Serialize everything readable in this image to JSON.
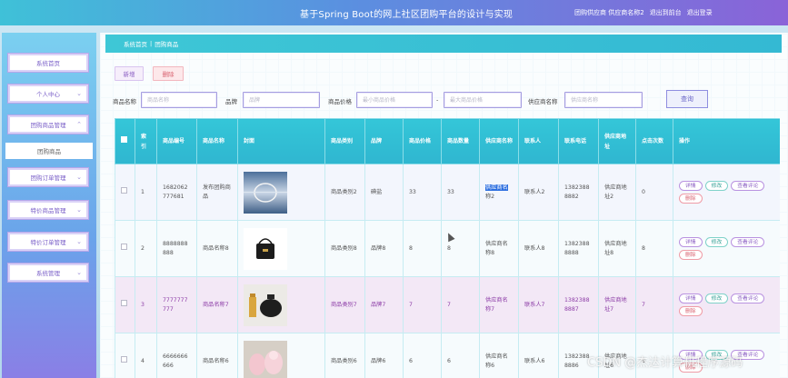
{
  "header": {
    "title": "基于Spring Boot的网上社区团购平台的设计与实现",
    "role_user": "团购供应商 供应商名称2",
    "back_label": "退出到前台",
    "logout_label": "退出登录"
  },
  "sidebar": {
    "items": [
      {
        "label": "系统首页"
      },
      {
        "label": "个人中心"
      },
      {
        "label": "团购商品管理"
      },
      {
        "label": "团购商品"
      },
      {
        "label": "团购订单管理"
      },
      {
        "label": "特价商品管理"
      },
      {
        "label": "特价订单管理"
      },
      {
        "label": "系统管理"
      }
    ]
  },
  "breadcrumb": {
    "home": "系统首页",
    "sep": "|",
    "current": "团购商品"
  },
  "toolbar": {
    "add_label": "新增",
    "delete_label": "删除"
  },
  "search": {
    "name_label": "商品名称",
    "name_placeholder": "商品名称",
    "brand_label": "品牌",
    "brand_placeholder": "品牌",
    "price_label": "商品价格",
    "price_min_placeholder": "最小商品价格",
    "price_sep": "-",
    "price_max_placeholder": "最大商品价格",
    "supplier_label": "供应商名称",
    "supplier_placeholder": "供应商名称",
    "search_button": "查询"
  },
  "table": {
    "headers": [
      "索引",
      "商品编号",
      "商品名称",
      "封面",
      "商品类别",
      "品牌",
      "商品价格",
      "商品数量",
      "供应商名称",
      "联系人",
      "联系电话",
      "供应商地址",
      "点击次数",
      "操作"
    ],
    "ops": {
      "detail": "详情",
      "edit": "修改",
      "review": "查看评论",
      "delete": "删除"
    },
    "rows": [
      {
        "index": "1",
        "code": "1682062777681",
        "name": "发布团购商品",
        "category": "商品类别2",
        "brand": "碘盐",
        "price": "33",
        "qty": "33",
        "supplier_hl": "供应商名",
        "supplier_rest": "称2",
        "contact": "联系人2",
        "phone": "13823888882",
        "address": "供应商地址2",
        "clicks": "0",
        "thumb": "lake"
      },
      {
        "index": "2",
        "code": "8888888888",
        "name": "商品名称8",
        "category": "商品类别8",
        "brand": "品牌8",
        "price": "8",
        "qty": "8",
        "supplier_hl": "",
        "supplier_rest": "供应商名称8",
        "contact": "联系人8",
        "phone": "13823888888",
        "address": "供应商地址8",
        "clicks": "8",
        "thumb": "bag"
      },
      {
        "index": "3",
        "code": "7777777777",
        "name": "商品名称7",
        "category": "商品类别7",
        "brand": "品牌7",
        "price": "7",
        "qty": "7",
        "supplier_hl": "",
        "supplier_rest": "供应商名称7",
        "contact": "联系人7",
        "phone": "13823888887",
        "address": "供应商地址7",
        "clicks": "7",
        "thumb": "tea"
      },
      {
        "index": "4",
        "code": "6666666666",
        "name": "商品名称6",
        "category": "商品类别6",
        "brand": "品牌6",
        "price": "6",
        "qty": "6",
        "supplier_hl": "",
        "supplier_rest": "供应商名称6",
        "contact": "联系人6",
        "phone": "13823888886",
        "address": "供应商地址6",
        "clicks": "6",
        "thumb": "toys"
      }
    ]
  },
  "watermark": "CSDN @杰达计算机程序源码"
}
